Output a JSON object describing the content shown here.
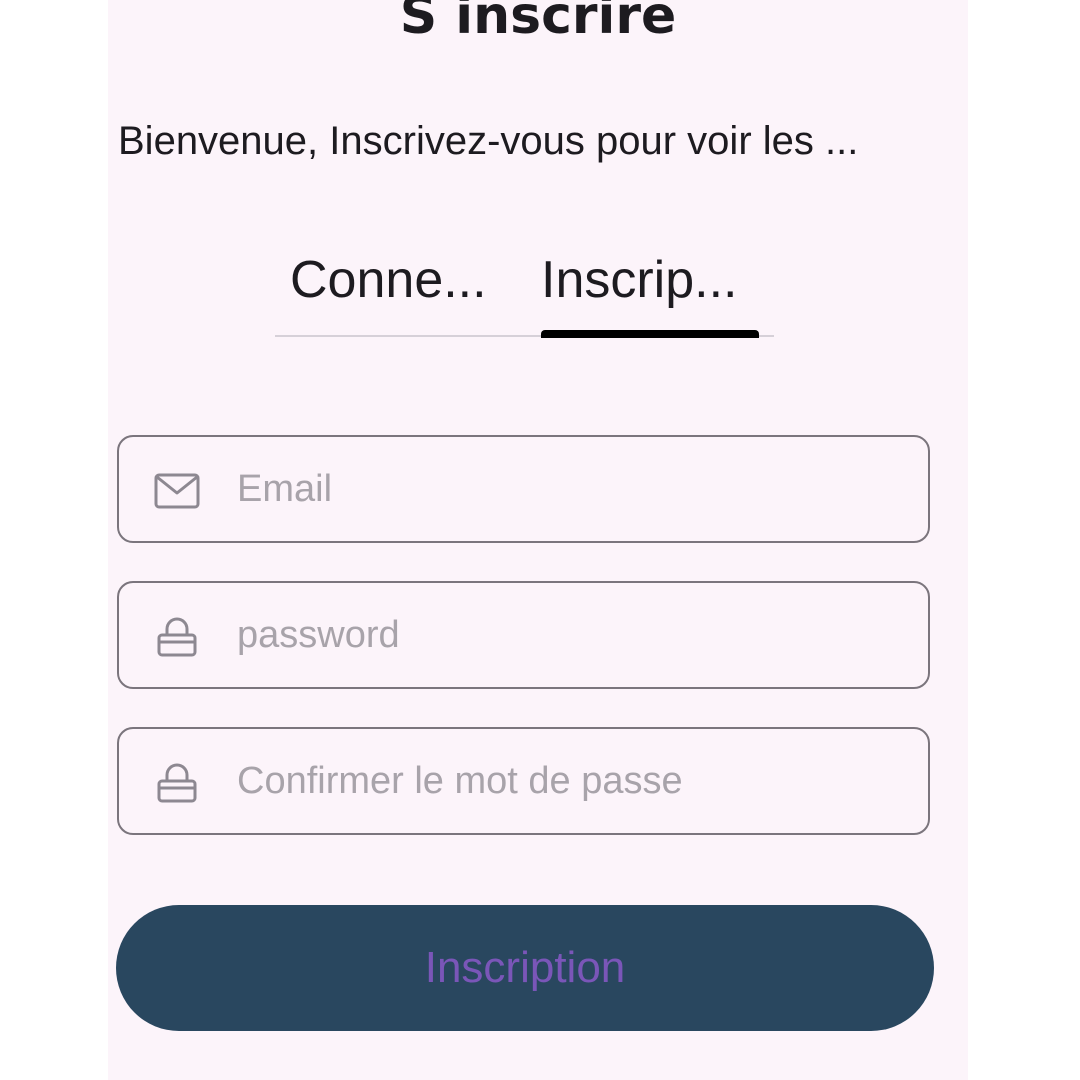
{
  "header": {
    "title": "S inscrire",
    "subtitle": "Bienvenue, Inscrivez-vous pour voir les ..."
  },
  "tabs": [
    {
      "label": "Conne...",
      "selected": false
    },
    {
      "label": "Inscrip...",
      "selected": true
    }
  ],
  "form": {
    "email": {
      "placeholder": "Email",
      "value": "",
      "icon": "mail-icon"
    },
    "password": {
      "placeholder": "password",
      "value": "",
      "icon": "lock-icon"
    },
    "confirm_password": {
      "placeholder": "Confirmer le mot de passe",
      "value": "",
      "icon": "lock-icon"
    }
  },
  "submit": {
    "label": "Inscription"
  },
  "colors": {
    "background": "#fcf4fa",
    "button": "#29475f",
    "button_text": "#7a56b8",
    "field_border": "#7b757d",
    "tab_indicator": "#000000"
  }
}
